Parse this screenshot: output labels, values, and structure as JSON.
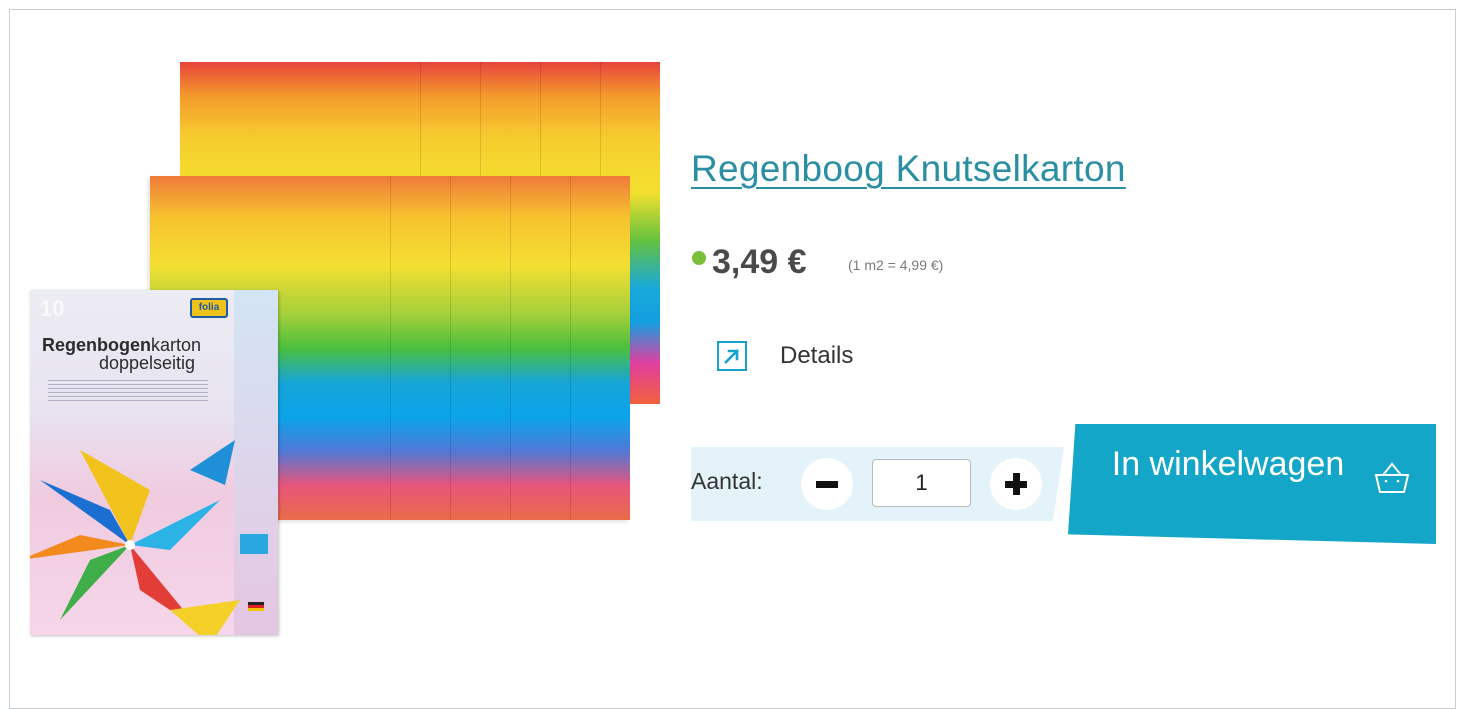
{
  "product": {
    "title": "Regenboog Knutselkarton",
    "price": "3,49 €",
    "unit_price": "(1 m2 = 4,99 €)",
    "stock_status_color": "#7bbf3b",
    "details_label": "Details",
    "details_icon": "external-arrow-icon"
  },
  "image": {
    "pack_count": "10",
    "pack_brand": "folia",
    "pack_title_bold": "Regenbogen",
    "pack_title_rest": "karton",
    "pack_subtitle": "doppelseitig"
  },
  "quantity": {
    "label": "Aantal:",
    "value": "1",
    "minus_icon": "minus-icon",
    "plus_icon": "plus-icon"
  },
  "cart": {
    "button_label": "In winkelwagen",
    "icon": "basket-icon"
  },
  "colors": {
    "accent": "#13a6c9",
    "title_link": "#2a8fa3",
    "qty_background": "#e3f3f9"
  }
}
